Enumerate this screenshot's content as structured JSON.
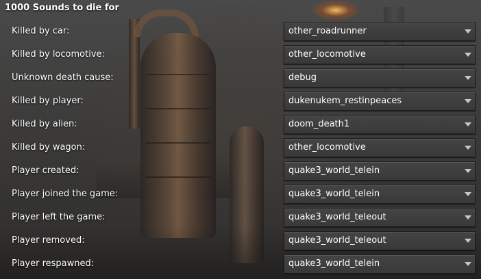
{
  "panel": {
    "title": "1000 Sounds to die for"
  },
  "rows": [
    {
      "label": "Killed by car:",
      "value": "other_roadrunner"
    },
    {
      "label": "Killed by locomotive:",
      "value": "other_locomotive"
    },
    {
      "label": "Unknown death cause:",
      "value": "debug"
    },
    {
      "label": "Killed by player:",
      "value": "dukenukem_restinpeaces"
    },
    {
      "label": "Killed by alien:",
      "value": "doom_death1"
    },
    {
      "label": "Killed by wagon:",
      "value": "other_locomotive"
    },
    {
      "label": "Player created:",
      "value": "quake3_world_telein"
    },
    {
      "label": "Player joined the game:",
      "value": "quake3_world_telein"
    },
    {
      "label": "Player left the game:",
      "value": "quake3_world_teleout"
    },
    {
      "label": "Player removed:",
      "value": "quake3_world_teleout"
    },
    {
      "label": "Player respawned:",
      "value": "quake3_world_telein"
    }
  ],
  "icons": {
    "dropdown_arrow": "chevron-down-icon"
  }
}
